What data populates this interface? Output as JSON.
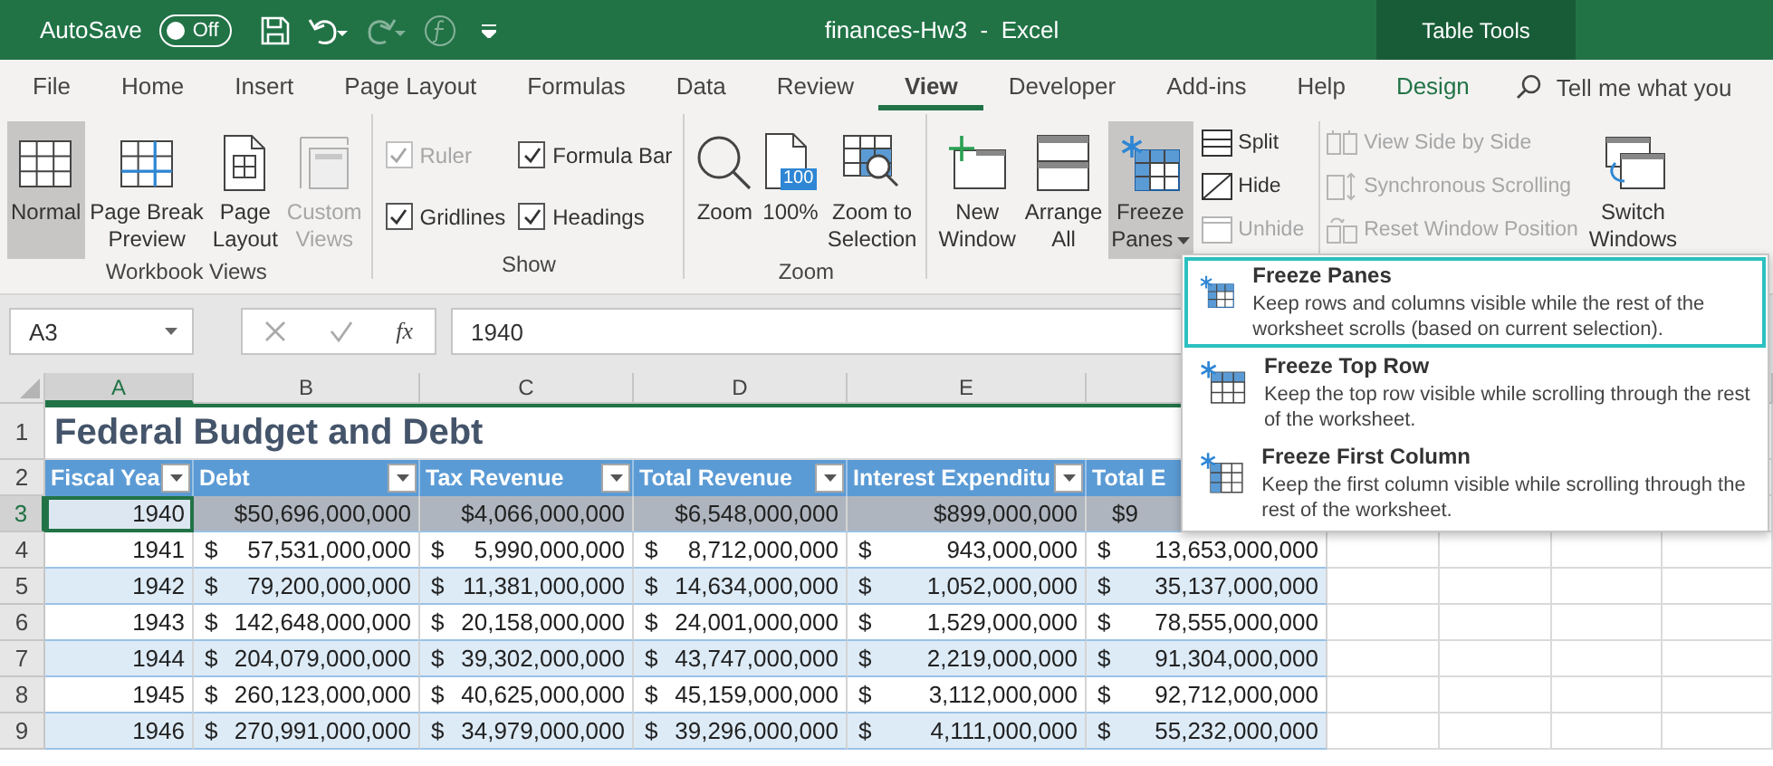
{
  "title_bar": {
    "autosave_label": "AutoSave",
    "autosave": {
      "on": false,
      "label": "Off"
    },
    "title": "finances-Hw3  -  Excel",
    "context_tab": "Table Tools"
  },
  "tabs": [
    {
      "label": "File",
      "selected": false,
      "kind": "normal"
    },
    {
      "label": "Home",
      "selected": false,
      "kind": "normal"
    },
    {
      "label": "Insert",
      "selected": false,
      "kind": "normal"
    },
    {
      "label": "Page Layout",
      "selected": false,
      "kind": "normal"
    },
    {
      "label": "Formulas",
      "selected": false,
      "kind": "normal"
    },
    {
      "label": "Data",
      "selected": false,
      "kind": "normal"
    },
    {
      "label": "Review",
      "selected": false,
      "kind": "normal"
    },
    {
      "label": "View",
      "selected": true,
      "kind": "normal"
    },
    {
      "label": "Developer",
      "selected": false,
      "kind": "normal"
    },
    {
      "label": "Add-ins",
      "selected": false,
      "kind": "normal"
    },
    {
      "label": "Help",
      "selected": false,
      "kind": "normal"
    },
    {
      "label": "Design",
      "selected": false,
      "kind": "context"
    }
  ],
  "search": {
    "placeholder": "Tell me what you"
  },
  "groups": [
    {
      "label": "Workbook Views",
      "items": [
        {
          "kind": "large",
          "lines": [
            "Normal"
          ],
          "selected": true,
          "disabled": false
        },
        {
          "kind": "large",
          "lines": [
            "Page Break",
            "Preview"
          ],
          "selected": false,
          "disabled": false
        },
        {
          "kind": "large",
          "lines": [
            "Page",
            "Layout"
          ],
          "selected": false,
          "disabled": false
        },
        {
          "kind": "large",
          "lines": [
            "Custom",
            "Views"
          ],
          "selected": false,
          "disabled": true
        }
      ]
    },
    {
      "label": "Show",
      "items": [
        {
          "kind": "checks",
          "items": [
            {
              "label": "Ruler",
              "checked": true,
              "disabled": true
            },
            {
              "label": "Gridlines",
              "checked": true,
              "disabled": false
            }
          ]
        },
        {
          "kind": "checks",
          "items": [
            {
              "label": "Formula Bar",
              "checked": true,
              "disabled": false
            },
            {
              "label": "Headings",
              "checked": true,
              "disabled": false
            }
          ]
        }
      ]
    },
    {
      "label": "Zoom",
      "items": [
        {
          "kind": "large",
          "lines": [
            "Zoom"
          ],
          "selected": false,
          "disabled": false
        },
        {
          "kind": "large",
          "lines": [
            "100%"
          ],
          "badge": "100",
          "selected": false,
          "disabled": false
        },
        {
          "kind": "large",
          "lines": [
            "Zoom to",
            "Selection"
          ],
          "selected": false,
          "disabled": false
        }
      ]
    },
    {
      "items": [
        {
          "kind": "large",
          "lines": [
            "New",
            "Window"
          ],
          "selected": false,
          "disabled": false
        },
        {
          "kind": "large",
          "lines": [
            "Arrange",
            "All"
          ],
          "selected": false,
          "disabled": false
        },
        {
          "kind": "large",
          "lines": [
            "Freeze",
            "Panes"
          ],
          "has_menu": true,
          "selected": true,
          "disabled": false
        },
        {
          "kind": "stack",
          "items": [
            {
              "label": "Split",
              "disabled": false
            },
            {
              "label": "Hide",
              "disabled": false
            },
            {
              "label": "Unhide",
              "disabled": true
            }
          ]
        },
        {
          "kind": "stack",
          "items": [
            {
              "label": "View Side by Side",
              "disabled": true
            },
            {
              "label": "Synchronous Scrolling",
              "disabled": true
            },
            {
              "label": "Reset Window Position",
              "disabled": true
            }
          ]
        },
        {
          "kind": "large",
          "lines": [
            "Switch",
            "Windows"
          ],
          "selected": false,
          "disabled": false
        }
      ]
    }
  ],
  "formula_bar": {
    "name_box": "A3",
    "function_label": "fx",
    "formula": "1940"
  },
  "sheet": {
    "columns": [
      {
        "label": "A",
        "selected": true
      },
      {
        "label": "B",
        "selected": false
      },
      {
        "label": "C",
        "selected": false
      },
      {
        "label": "D",
        "selected": false
      },
      {
        "label": "E",
        "selected": false
      }
    ],
    "title_row": {
      "number": "1",
      "title": "Federal Budget and Debt"
    },
    "header_row": {
      "number": "2",
      "headers": [
        "Fiscal Yea",
        "Debt",
        "Tax Revenue",
        "Total Revenue",
        "Interest Expenditu",
        "Total E"
      ]
    },
    "rows": [
      {
        "number": "3",
        "selected": true,
        "cells": [
          {
            "kind": "plain",
            "amount": "1940"
          },
          {
            "kind": "plain",
            "amount": "$50,696,000,000"
          },
          {
            "kind": "plain",
            "amount": "$4,066,000,000"
          },
          {
            "kind": "plain",
            "amount": "$6,548,000,000"
          },
          {
            "kind": "plain",
            "amount": "$899,000,000"
          },
          {
            "kind": "partial",
            "amount": "$9"
          }
        ]
      },
      {
        "number": "4",
        "selected": false,
        "cells": [
          {
            "kind": "plain",
            "amount": "1941"
          },
          {
            "kind": "currency",
            "currency": "$",
            "amount": "57,531,000,000"
          },
          {
            "kind": "currency",
            "currency": "$",
            "amount": "5,990,000,000"
          },
          {
            "kind": "currency",
            "currency": "$",
            "amount": "8,712,000,000"
          },
          {
            "kind": "currency",
            "currency": "$",
            "amount": "943,000,000"
          },
          {
            "kind": "currency",
            "currency": "$",
            "amount": "13,653,000,000"
          }
        ]
      },
      {
        "number": "5",
        "selected": false,
        "cells": [
          {
            "kind": "plain",
            "amount": "1942"
          },
          {
            "kind": "currency",
            "currency": "$",
            "amount": "79,200,000,000"
          },
          {
            "kind": "currency",
            "currency": "$",
            "amount": "11,381,000,000"
          },
          {
            "kind": "currency",
            "currency": "$",
            "amount": "14,634,000,000"
          },
          {
            "kind": "currency",
            "currency": "$",
            "amount": "1,052,000,000"
          },
          {
            "kind": "currency",
            "currency": "$",
            "amount": "35,137,000,000"
          }
        ]
      },
      {
        "number": "6",
        "selected": false,
        "cells": [
          {
            "kind": "plain",
            "amount": "1943"
          },
          {
            "kind": "currency",
            "currency": "$",
            "amount": "142,648,000,000"
          },
          {
            "kind": "currency",
            "currency": "$",
            "amount": "20,158,000,000"
          },
          {
            "kind": "currency",
            "currency": "$",
            "amount": "24,001,000,000"
          },
          {
            "kind": "currency",
            "currency": "$",
            "amount": "1,529,000,000"
          },
          {
            "kind": "currency",
            "currency": "$",
            "amount": "78,555,000,000"
          }
        ]
      },
      {
        "number": "7",
        "selected": false,
        "cells": [
          {
            "kind": "plain",
            "amount": "1944"
          },
          {
            "kind": "currency",
            "currency": "$",
            "amount": "204,079,000,000"
          },
          {
            "kind": "currency",
            "currency": "$",
            "amount": "39,302,000,000"
          },
          {
            "kind": "currency",
            "currency": "$",
            "amount": "43,747,000,000"
          },
          {
            "kind": "currency",
            "currency": "$",
            "amount": "2,219,000,000"
          },
          {
            "kind": "currency",
            "currency": "$",
            "amount": "91,304,000,000"
          }
        ]
      },
      {
        "number": "8",
        "selected": false,
        "cells": [
          {
            "kind": "plain",
            "amount": "1945"
          },
          {
            "kind": "currency",
            "currency": "$",
            "amount": "260,123,000,000"
          },
          {
            "kind": "currency",
            "currency": "$",
            "amount": "40,625,000,000"
          },
          {
            "kind": "currency",
            "currency": "$",
            "amount": "45,159,000,000"
          },
          {
            "kind": "currency",
            "currency": "$",
            "amount": "3,112,000,000"
          },
          {
            "kind": "currency",
            "currency": "$",
            "amount": "92,712,000,000"
          }
        ]
      },
      {
        "number": "9",
        "selected": false,
        "cells": [
          {
            "kind": "plain",
            "amount": "1946"
          },
          {
            "kind": "currency",
            "currency": "$",
            "amount": "270,991,000,000"
          },
          {
            "kind": "currency",
            "currency": "$",
            "amount": "34,979,000,000"
          },
          {
            "kind": "currency",
            "currency": "$",
            "amount": "39,296,000,000"
          },
          {
            "kind": "currency",
            "currency": "$",
            "amount": "4,111,000,000"
          },
          {
            "kind": "currency",
            "currency": "$",
            "amount": "55,232,000,000"
          }
        ]
      }
    ]
  },
  "menu": {
    "items": [
      {
        "title": "Freeze Panes",
        "description": "Keep rows and columns visible while the rest of the worksheet scrolls (based on current selection).",
        "selected": true
      },
      {
        "title": "Freeze Top Row",
        "description": "Keep the top row visible while scrolling through the rest of the worksheet.",
        "selected": false
      },
      {
        "title": "Freeze First Column",
        "description": "Keep the first column visible while scrolling through the rest of the worksheet.",
        "selected": false
      }
    ]
  }
}
